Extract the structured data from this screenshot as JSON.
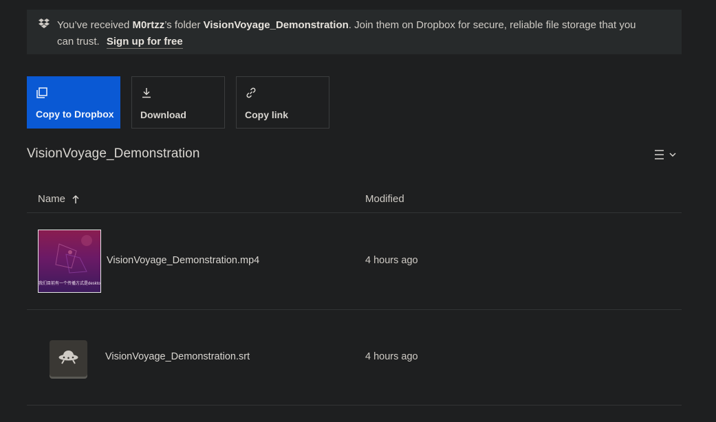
{
  "banner": {
    "prefix": "You’ve received ",
    "user": "M0rtzz",
    "middle": "’s folder ",
    "folder": "VisionVoyage_Demonstration",
    "suffix": ". Join them on Dropbox for secure, reliable file storage that you can trust.",
    "signup_label": "Sign up for free",
    "icon": "dropbox-logo-icon"
  },
  "actions": [
    {
      "label": "Copy to Dropbox",
      "icon": "copy-icon"
    },
    {
      "label": "Download",
      "icon": "download-icon"
    },
    {
      "label": "Copy link",
      "icon": "link-icon"
    }
  ],
  "folder_title": "VisionVoyage_Demonstration",
  "view_toggle": {
    "icon": "list-view-icon"
  },
  "table": {
    "columns": [
      "Name",
      "Modified"
    ],
    "sort": {
      "column": "Name",
      "direction": "ascending"
    },
    "rows": [
      {
        "name": "VisionVoyage_Demonstration.mp4",
        "modified": "4 hours ago",
        "thumbnail_caption": "我们目前有一个传播方式是desktop"
      },
      {
        "name": "VisionVoyage_Demonstration.srt",
        "modified": "4 hours ago",
        "icon": "ufo-file-icon"
      }
    ]
  },
  "colors": {
    "accent": "#0a59d4",
    "background": "#1e1f20",
    "banner_bg": "#272a2b"
  }
}
